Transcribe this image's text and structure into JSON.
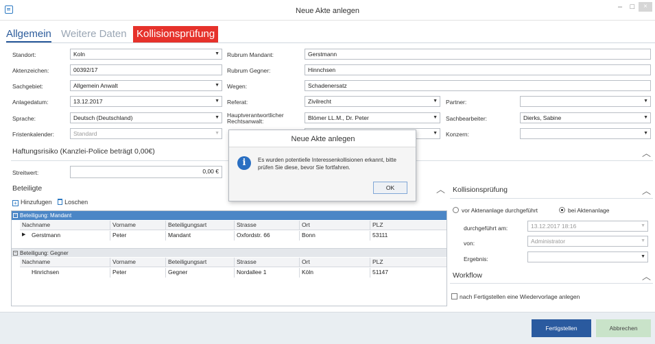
{
  "window": {
    "title": "Neue Akte anlegen",
    "minimize": "–",
    "maximize": "□",
    "close": "×"
  },
  "tabs": [
    {
      "label": "Allgemein"
    },
    {
      "label": "Weitere Daten"
    },
    {
      "label": "Kollisionsprüfung"
    }
  ],
  "form": {
    "standort": {
      "label": "Standort:",
      "value": "Koln"
    },
    "aktenzeichen": {
      "label": "Aktenzeichen:",
      "value": "00392/17"
    },
    "sachgebiet": {
      "label": "Sachgebiet:",
      "value": "Allgemein Anwalt"
    },
    "anlagedatum": {
      "label": "Anlagedatum:",
      "value": "13.12.2017"
    },
    "sprache": {
      "label": "Sprache:",
      "value": "Deutsch (Deutschland)"
    },
    "fristenkalender": {
      "label": "Fristenkalender:",
      "value": "Standard"
    },
    "rubrum_mandant": {
      "label": "Rubrum Mandant:",
      "value": "Gerstmann"
    },
    "rubrum_gegner": {
      "label": "Rubrum Gegner:",
      "value": "Hinnchsen"
    },
    "wegen": {
      "label": "Wegen:",
      "value": "Schadenersatz"
    },
    "referat": {
      "label": "Referat:",
      "value": "Zivilrecht"
    },
    "hauptverantwortlicher": {
      "label1": "Hauptverantwortlicher",
      "label2": "Rechtsanwalt:",
      "value": "Blömer LL.M., Dr. Peter"
    },
    "partner": {
      "label": "Partner:",
      "value": ""
    },
    "sachbearbeiter": {
      "label": "Sachbearbeiter:",
      "value": "Dierks, Sabine"
    },
    "konzern": {
      "label": "Konzern:",
      "value": ""
    }
  },
  "haftung": {
    "title": "Haftungsrisiko (Kanzlei-Police beträgt 0,00€)",
    "streitwert_label": "Streitwert:",
    "streitwert_value": "0,00 €"
  },
  "beteiligte": {
    "title": "Beteiligte",
    "add_label": "Hinzufugen",
    "delete_label": "Loschen",
    "columns": [
      "Nachname",
      "Vorname",
      "Beteiligungsart",
      "Strasse",
      "Ort",
      "PLZ"
    ],
    "groups": [
      {
        "label": "Beteiligung: Mandant",
        "rows": [
          [
            "Gerstmann",
            "Peter",
            "Mandant",
            "Oxfordstr. 66",
            "Bonn",
            "53111"
          ]
        ]
      },
      {
        "label": "Beteiligung: Gegner",
        "rows": [
          [
            "Hinrichsen",
            "Peter",
            "Gegner",
            "Nordallee 1",
            "Köln",
            "51147"
          ]
        ]
      }
    ]
  },
  "kollision": {
    "title": "Kollisionsprüfung",
    "option_before": "vor Aktenanlage durchgeführt",
    "option_on": "bei Aktenanlage",
    "durchgefuehrt_label": "durchgeführt am:",
    "durchgefuehrt_value": "13.12.2017 18:16",
    "von_label": "von:",
    "von_value": "Administrator",
    "ergebnis_label": "Ergebnis:",
    "ergebnis_value": ""
  },
  "workflow": {
    "title": "Workflow",
    "checkbox_label": "nach Fertigstellen eine Wiedervorlage anlegen"
  },
  "dialog": {
    "title": "Neue Akte anlegen",
    "message": "Es wurden potentielle Interessenkollisionen erkannt, bitte prüfen Sie diese, bevor Sie fortfahren.",
    "ok_label": "OK"
  },
  "footer": {
    "finish_label": "Fertigstellen",
    "cancel_label": "Abbrechen"
  },
  "colors": {
    "accent": "#2a5a9f",
    "tab_active_red": "#e6322b",
    "group_header_blue": "#4b86c6",
    "cancel_green": "#c9e3c9"
  }
}
